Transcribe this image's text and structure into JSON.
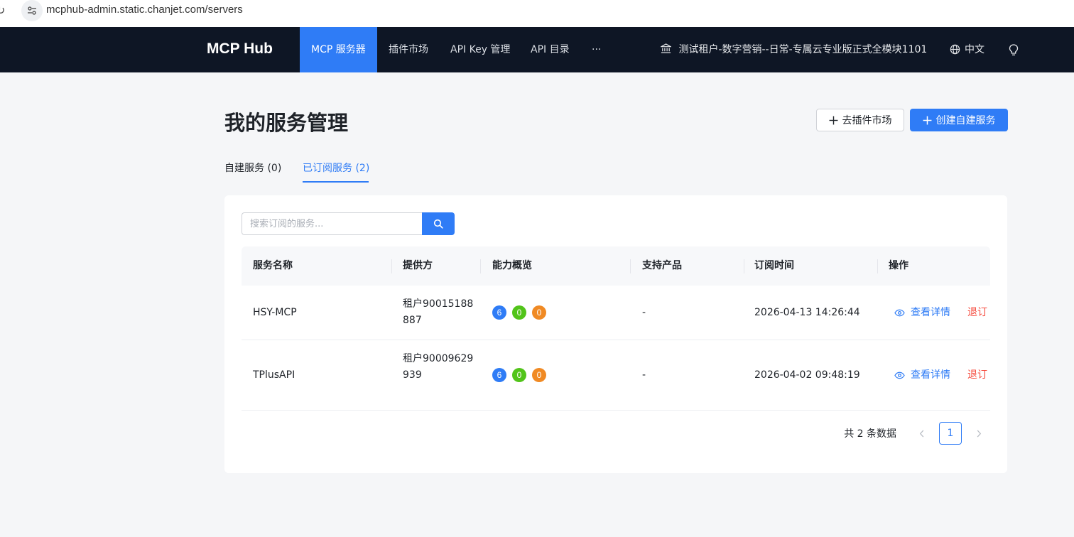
{
  "browser": {
    "url": "mcphub-admin.static.chanjet.com/servers"
  },
  "nav": {
    "brand": "MCP Hub",
    "items": [
      {
        "label": "MCP 服务器",
        "active": true
      },
      {
        "label": "插件市场"
      },
      {
        "label": "API Key 管理"
      },
      {
        "label": "API 目录"
      },
      {
        "label": "···"
      }
    ],
    "tenant": "测试租户-数字营销--日常-专属云专业版正式全模块1101",
    "language": "中文"
  },
  "page": {
    "title": "我的服务管理",
    "btn_market": "去插件市场",
    "btn_create": "创建自建服务"
  },
  "tabs": [
    {
      "label": "自建服务 (0)"
    },
    {
      "label": "已订阅服务 (2)",
      "active": true
    }
  ],
  "search": {
    "placeholder": "搜索订阅的服务..."
  },
  "table": {
    "columns": [
      "服务名称",
      "提供方",
      "能力概览",
      "支持产品",
      "订阅时间",
      "操作"
    ],
    "rows": [
      {
        "name": "HSY-MCP",
        "provider": "租户90015188887",
        "caps": [
          "6",
          "0",
          "0"
        ],
        "product": "-",
        "time": "2026-04-13 14:26:44",
        "detail": "查看详情",
        "unsub": "退订"
      },
      {
        "name": "TPlusAPI",
        "provider": "租户90009629939",
        "caps": [
          "6",
          "0",
          "0"
        ],
        "product": "-",
        "time": "2026-04-02 09:48:19",
        "detail": "查看详情",
        "unsub": "退订"
      }
    ]
  },
  "pagination": {
    "total": "共 2 条数据",
    "current": "1"
  },
  "colors": {
    "primary": "#2f7cf6",
    "nav_bg": "#0e1625",
    "cap_blue": "#2f7cf6",
    "cap_green": "#52c41a",
    "cap_orange": "#f08a24",
    "danger": "#f5483b"
  }
}
